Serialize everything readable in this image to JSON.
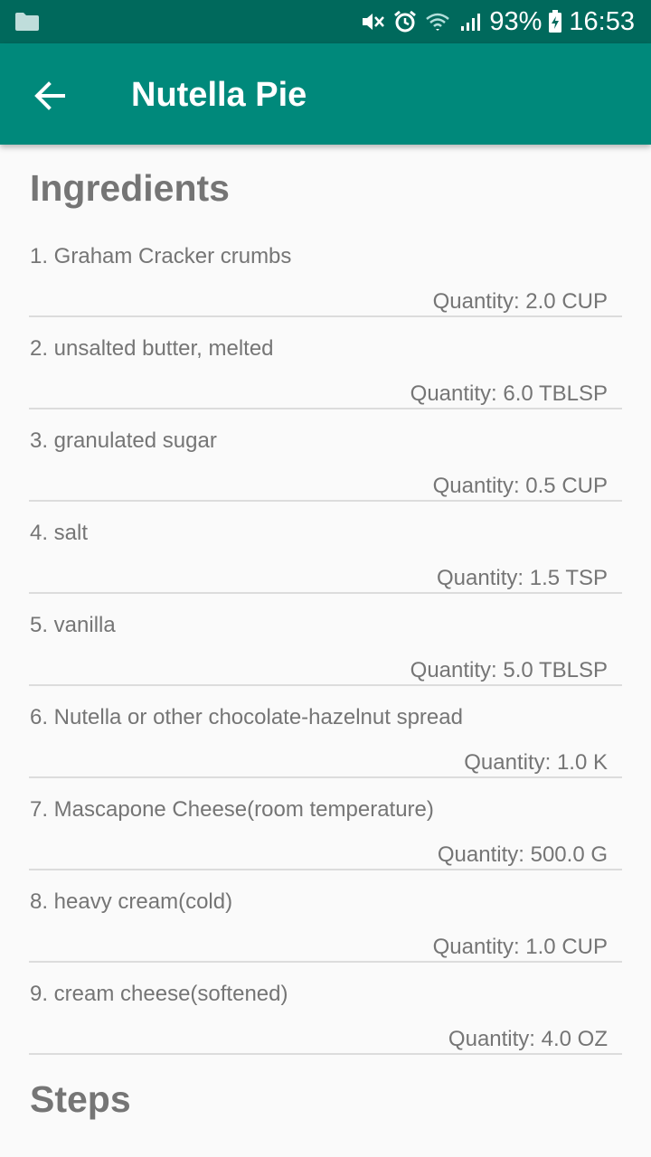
{
  "status_bar": {
    "battery": "93%",
    "time": "16:53",
    "icons": [
      "folder-icon",
      "mute-icon",
      "alarm-icon",
      "wifi-icon",
      "signal-icon",
      "battery-charging-icon"
    ]
  },
  "app_bar": {
    "title": "Nutella Pie",
    "back_icon": "arrow-back-icon"
  },
  "sections": {
    "ingredients_title": "Ingredients",
    "steps_title": "Steps"
  },
  "ingredients": [
    {
      "name": "1. Graham Cracker crumbs",
      "quantity": "Quantity: 2.0 CUP"
    },
    {
      "name": "2. unsalted butter, melted",
      "quantity": "Quantity: 6.0 TBLSP"
    },
    {
      "name": "3. granulated sugar",
      "quantity": "Quantity: 0.5 CUP"
    },
    {
      "name": "4. salt",
      "quantity": "Quantity: 1.5 TSP"
    },
    {
      "name": "5. vanilla",
      "quantity": "Quantity: 5.0 TBLSP"
    },
    {
      "name": "6. Nutella or other chocolate-hazelnut spread",
      "quantity": "Quantity: 1.0 K"
    },
    {
      "name": "7. Mascapone Cheese(room temperature)",
      "quantity": "Quantity: 500.0 G"
    },
    {
      "name": "8. heavy cream(cold)",
      "quantity": "Quantity: 1.0 CUP"
    },
    {
      "name": "9. cream cheese(softened)",
      "quantity": "Quantity: 4.0 OZ"
    }
  ],
  "colors": {
    "status_bar": "#00695c",
    "app_bar": "#00897b",
    "text": "#757575",
    "background": "#fafafa"
  }
}
